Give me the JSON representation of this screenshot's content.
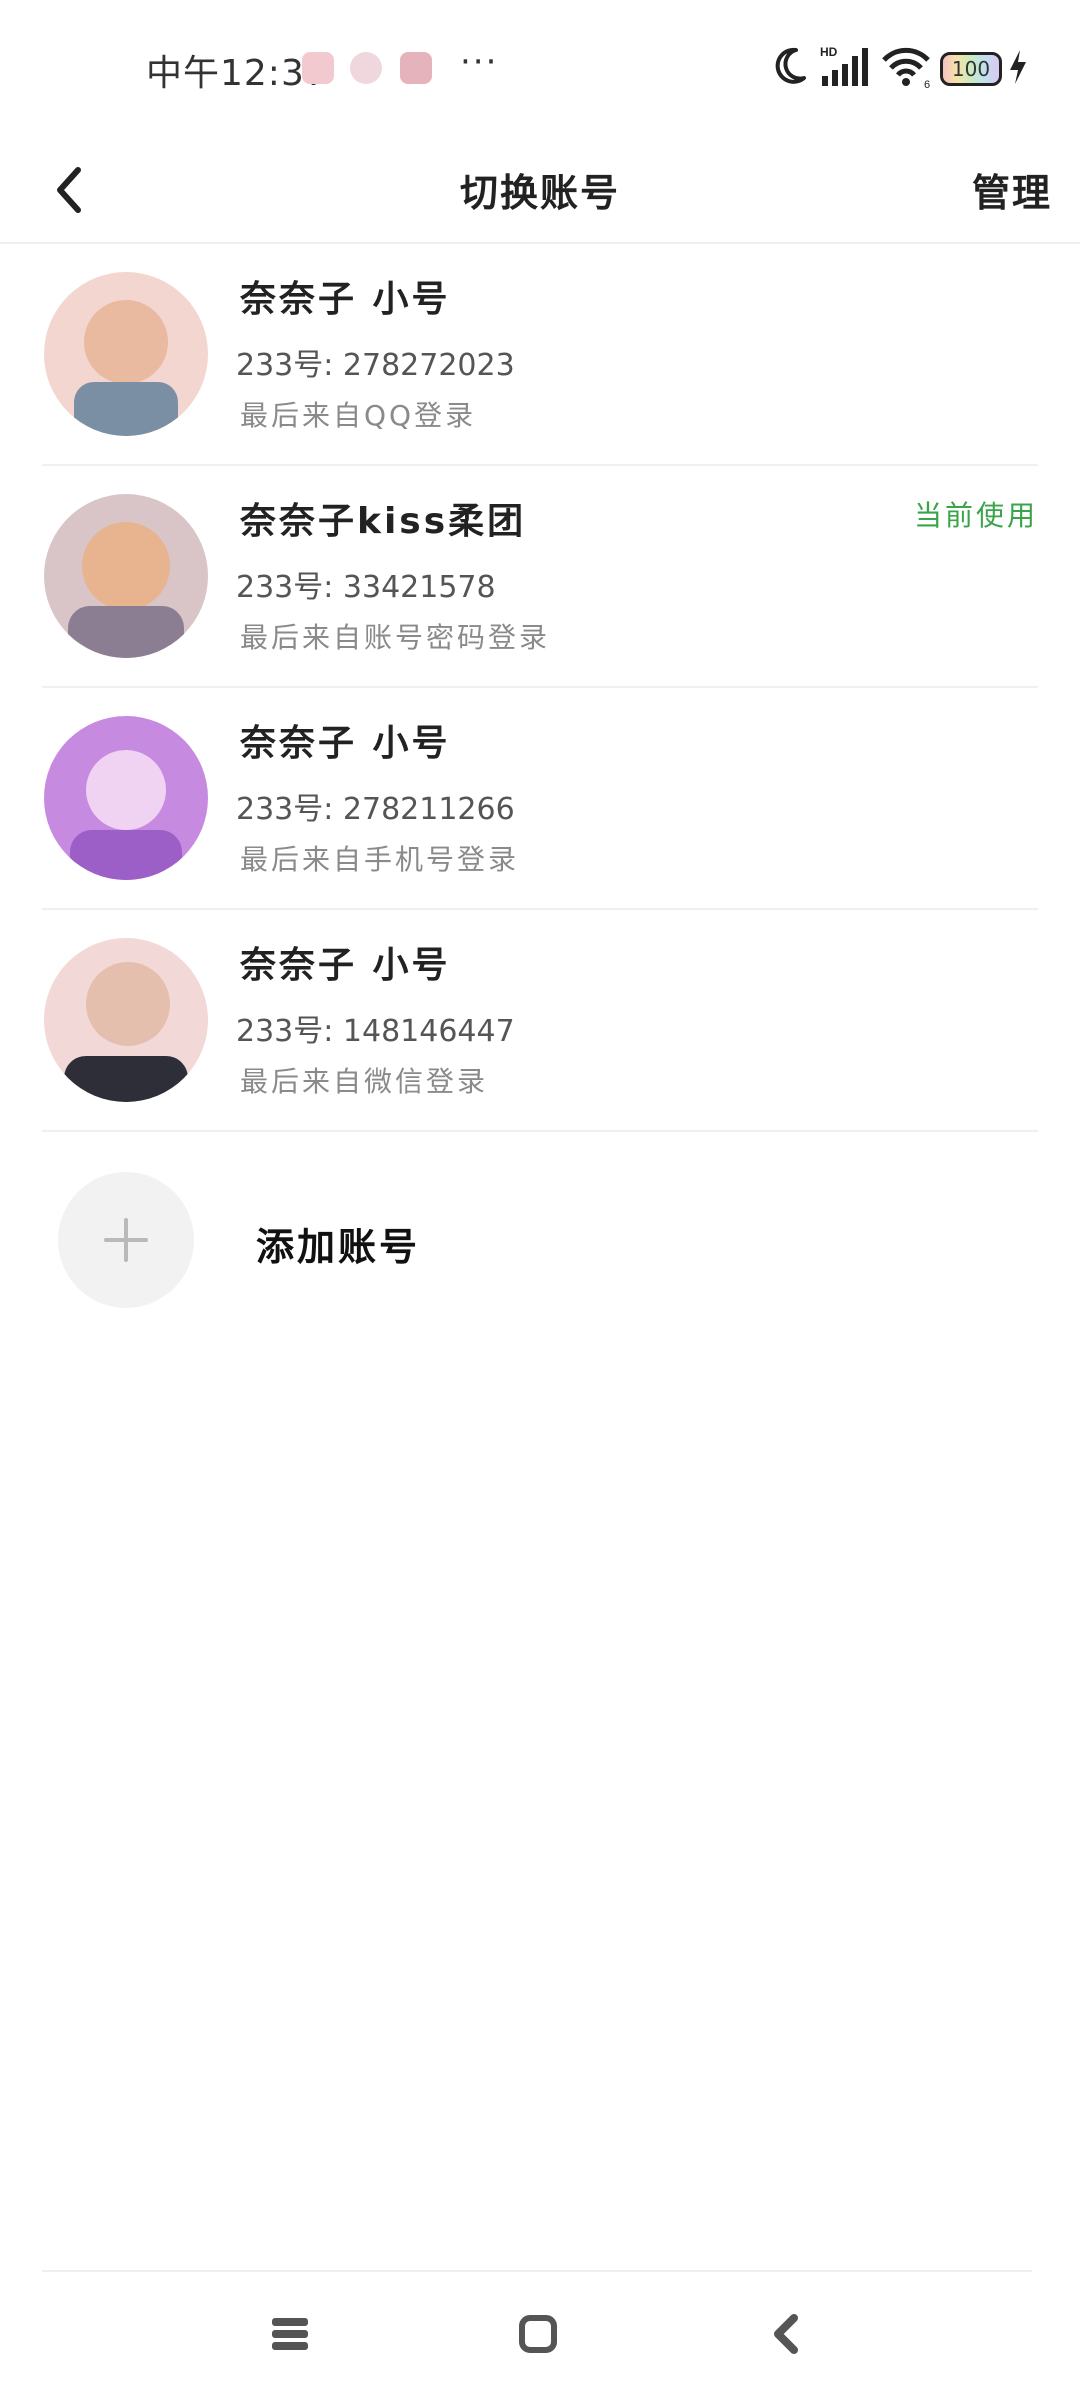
{
  "status_bar": {
    "time": "中午12:37",
    "more": "···",
    "battery_level": "100",
    "network_label": "HD",
    "wifi_label": "6",
    "icons": [
      "notification-app-icon",
      "notification-app-icon",
      "notification-app-icon",
      "moon-icon",
      "signal-icon",
      "wifi-icon",
      "battery-icon",
      "charging-icon"
    ]
  },
  "header": {
    "title": "切换账号",
    "manage_label": "管理",
    "back_icon": "chevron-left-icon"
  },
  "accounts": [
    {
      "name": "奈奈子 小号",
      "id": "233号: 278272023",
      "login": "最后来自QQ登录",
      "current": "",
      "avatar_colors": [
        "#f3d6cf",
        "#e9b9a0",
        "#7a8fa3"
      ]
    },
    {
      "name": "奈奈子kiss柔团",
      "id": "233号: 33421578",
      "login": "最后来自账号密码登录",
      "current": "当前使用",
      "avatar_colors": [
        "#d9c4c8",
        "#e7b48f",
        "#8b7e93"
      ]
    },
    {
      "name": "奈奈子 小号",
      "id": "233号: 278211266",
      "login": "最后来自手机号登录",
      "current": "",
      "avatar_colors": [
        "#c68ae0",
        "#9b5fc7",
        "#f0d2f2"
      ]
    },
    {
      "name": "奈奈子 小号",
      "id": "233号: 148146447",
      "login": "最后来自微信登录",
      "current": "",
      "avatar_colors": [
        "#f2d8d6",
        "#e5bfae",
        "#2e2e38"
      ]
    }
  ],
  "add_account": {
    "label": "添加账号",
    "icon": "plus-icon"
  },
  "colors": {
    "accent_current": "#3aa44a",
    "divider": "#f0f0f0",
    "secondary_text": "#8a8a8a"
  },
  "system_nav": {
    "icons": [
      "menu-icon",
      "home-icon",
      "back-icon"
    ]
  }
}
